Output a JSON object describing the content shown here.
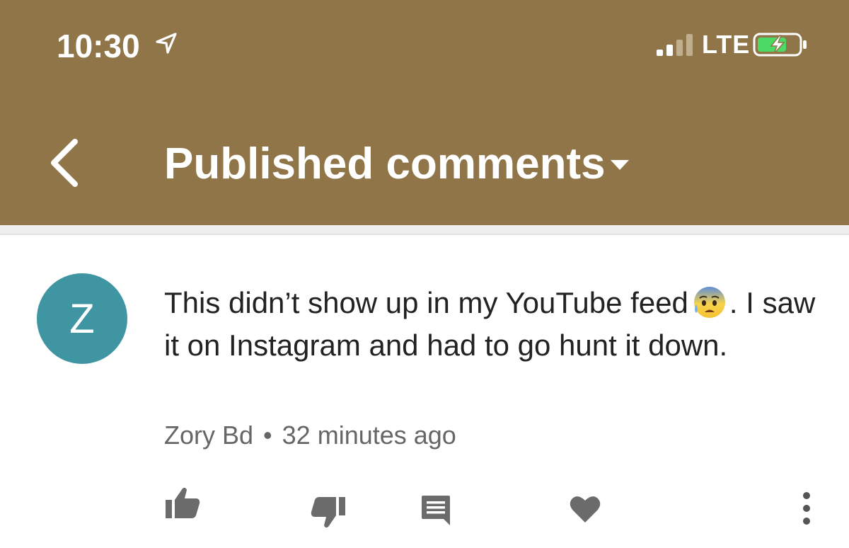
{
  "status_bar": {
    "time": "10:30",
    "carrier": "LTE",
    "signal_bars_active": 2,
    "signal_bars_total": 4
  },
  "header": {
    "title": "Published comments",
    "background_color": "#907548"
  },
  "comment": {
    "avatar_letter": "Z",
    "avatar_color": "#3f96a2",
    "text_before_emoji": "This didn’t show up in my YouTube feed",
    "emoji": "anxious-face-with-sweat",
    "text_after_emoji": ". I saw it on Instagram and had to go hunt it down.",
    "author": "Zory Bd",
    "separator": "•",
    "time_ago": "32 minutes ago"
  },
  "actions": {
    "icon_color": "#6b6b6b",
    "icons": [
      "thumbs-up-icon",
      "thumbs-down-icon",
      "reply-icon",
      "heart-icon",
      "more-vert-icon"
    ]
  }
}
